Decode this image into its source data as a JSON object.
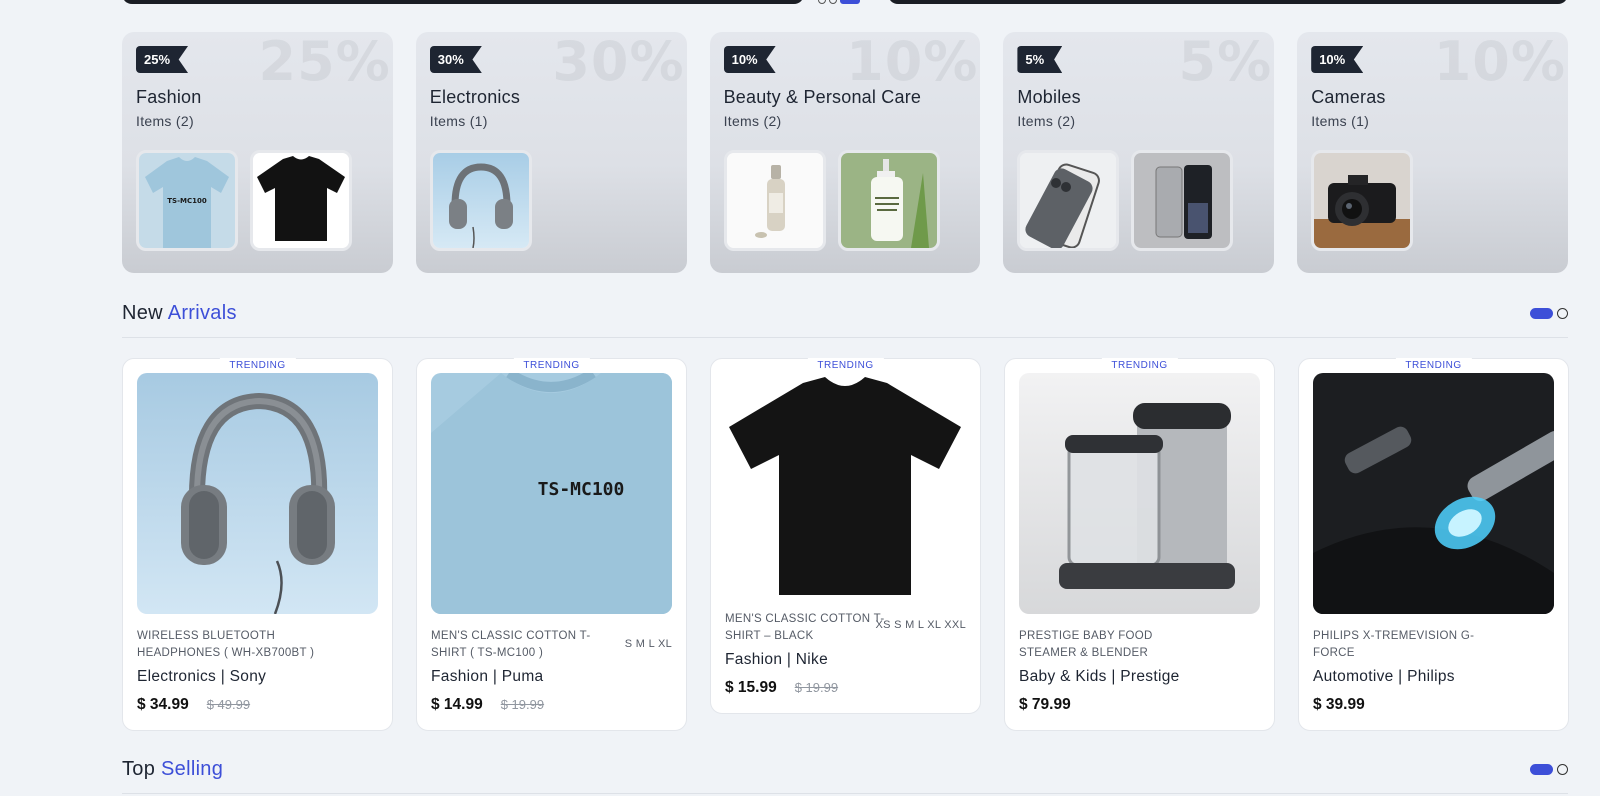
{
  "categories": [
    {
      "discount": "25%",
      "title": "Fashion",
      "count": "Items (2)",
      "thumbs": [
        "tshirt-blue",
        "tshirt-black"
      ]
    },
    {
      "discount": "30%",
      "title": "Electronics",
      "count": "Items (1)",
      "thumbs": [
        "headphones"
      ]
    },
    {
      "discount": "10%",
      "title": "Beauty & Personal Care",
      "count": "Items (2)",
      "thumbs": [
        "serum-bottle",
        "face-wash"
      ]
    },
    {
      "discount": "5%",
      "title": "Mobiles",
      "count": "Items (2)",
      "thumbs": [
        "iphone",
        "android-phone"
      ]
    },
    {
      "discount": "10%",
      "title": "Cameras",
      "count": "Items (1)",
      "thumbs": [
        "camera"
      ]
    }
  ],
  "new_arrivals": {
    "title_plain": "New",
    "title_highlight": "Arrivals"
  },
  "top_selling": {
    "title_plain": "Top",
    "title_highlight": "Selling"
  },
  "products": [
    {
      "badge": "TRENDING",
      "name": "WIRELESS BLUETOOTH HEADPHONES ( WH-XB700BT )",
      "sizes": "",
      "category_brand": "Electronics | Sony",
      "price": "$ 34.99",
      "old_price": "$ 49.99"
    },
    {
      "badge": "TRENDING",
      "name": "MEN'S CLASSIC COTTON T-SHIRT ( TS-MC100 )",
      "sizes": "S M L XL",
      "category_brand": "Fashion | Puma",
      "price": "$ 14.99",
      "old_price": "$ 19.99"
    },
    {
      "badge": "TRENDING",
      "name": "MEN'S CLASSIC COTTON T-SHIRT – BLACK",
      "sizes": "XS S M L XL XXL",
      "category_brand": "Fashion | Nike",
      "price": "$ 15.99",
      "old_price": "$ 19.99"
    },
    {
      "badge": "TRENDING",
      "name": "PRESTIGE BABY FOOD STEAMER & BLENDER",
      "sizes": "",
      "category_brand": "Baby & Kids | Prestige",
      "price": "$ 79.99",
      "old_price": ""
    },
    {
      "badge": "TRENDING",
      "name": "PHILIPS X-TREMEVISION G-FORCE",
      "sizes": "",
      "category_brand": "Automotive | Philips",
      "price": "$ 39.99",
      "old_price": ""
    }
  ],
  "tshirt_print": "TS-MC100",
  "colors": {
    "accent": "#3d4fd8",
    "dark": "#1e2532"
  }
}
